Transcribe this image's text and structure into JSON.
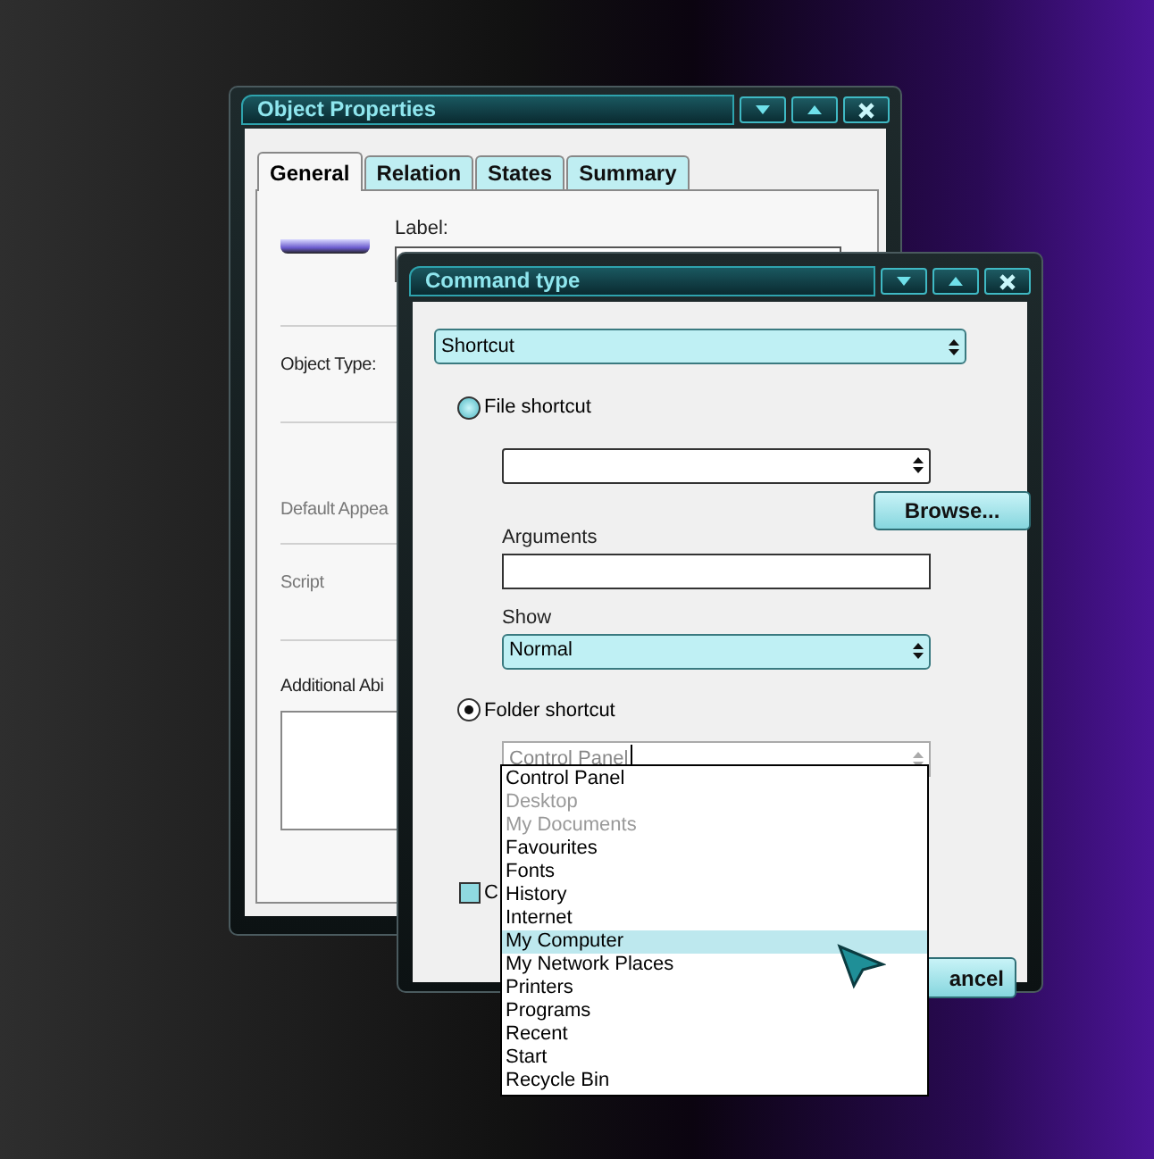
{
  "object_properties": {
    "title": "Object Properties",
    "tabs": [
      {
        "label": "General",
        "selected": true
      },
      {
        "label": "Relation",
        "selected": false
      },
      {
        "label": "States",
        "selected": false
      },
      {
        "label": "Summary",
        "selected": false
      }
    ],
    "label_field": {
      "label": "Label:"
    },
    "fields": [
      {
        "label": "Object Type:",
        "disabled": false
      },
      {
        "label": "Default Appea",
        "disabled": true
      },
      {
        "label": "Script",
        "disabled": true
      },
      {
        "label": "Additional Abi",
        "disabled": false
      }
    ]
  },
  "command_type": {
    "title": "Command type",
    "shortcut_type": "Shortcut",
    "file_shortcut": {
      "label": "File shortcut",
      "selected": false
    },
    "browse_button": "Browse...",
    "arguments_label": "Arguments",
    "show_label": "Show",
    "show_value": "Normal",
    "folder_shortcut": {
      "label": "Folder shortcut",
      "selected": true
    },
    "folder_value": "Control Panel",
    "folder_list": [
      {
        "label": "Control Panel",
        "disabled": false,
        "selected": false
      },
      {
        "label": "Desktop",
        "disabled": true,
        "selected": false
      },
      {
        "label": "My Documents",
        "disabled": true,
        "selected": false
      },
      {
        "label": "Favourites",
        "disabled": false,
        "selected": false
      },
      {
        "label": "Fonts",
        "disabled": false,
        "selected": false
      },
      {
        "label": "History",
        "disabled": false,
        "selected": false
      },
      {
        "label": "Internet",
        "disabled": false,
        "selected": false
      },
      {
        "label": "My Computer",
        "disabled": false,
        "selected": true
      },
      {
        "label": "My Network Places",
        "disabled": false,
        "selected": false
      },
      {
        "label": "Printers",
        "disabled": false,
        "selected": false
      },
      {
        "label": "Programs",
        "disabled": false,
        "selected": false
      },
      {
        "label": "Recent",
        "disabled": false,
        "selected": false
      },
      {
        "label": "Start",
        "disabled": false,
        "selected": false
      },
      {
        "label": "Recycle Bin",
        "disabled": false,
        "selected": false
      }
    ],
    "checkbox": {
      "label": "C",
      "checked": false
    },
    "cancel_button": "ancel"
  }
}
